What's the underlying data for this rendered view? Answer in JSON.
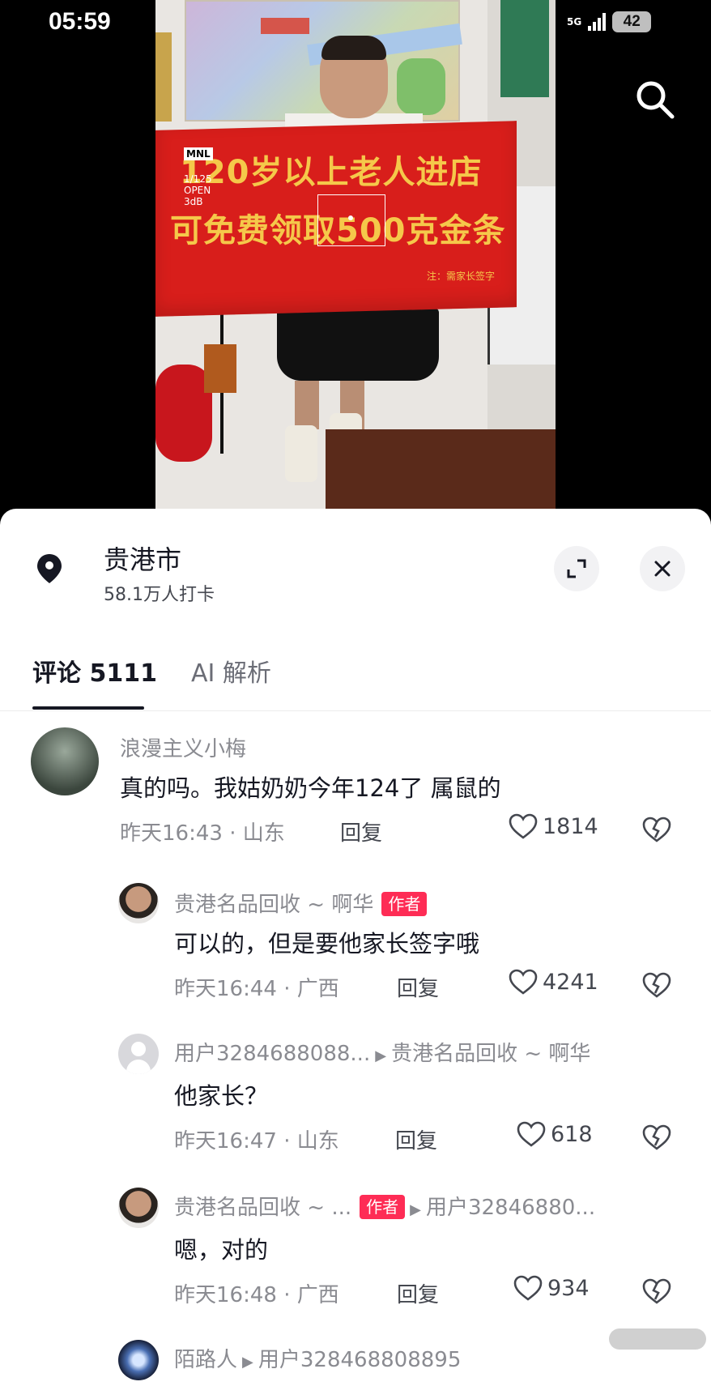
{
  "status_bar": {
    "time": "05:59",
    "network": "5G",
    "battery": "42"
  },
  "video": {
    "banner_line1": "120岁以上老人进店",
    "banner_line2": "可免费领取500克金条",
    "banner_note": "注：需家长签字",
    "camera_mode": "MNL",
    "camera_info": "1/125\nOPEN\n3dB"
  },
  "location": {
    "name": "贵港市",
    "checkins": "58.1万人打卡"
  },
  "tabs": [
    {
      "label": "评论 5111",
      "active": true
    },
    {
      "label": "AI 解析",
      "active": false
    }
  ],
  "comments": [
    {
      "user": "浪漫主义小梅",
      "text": "真的吗。我姑奶奶今年124了 属鼠的",
      "time": "昨天16:43 · 山东",
      "reply": "回复",
      "likes": "1814"
    },
    {
      "user": "贵港名品回收 ~ 啊华",
      "badge": "作者",
      "text": "可以的，但是要他家长签字哦",
      "time": "昨天16:44 · 广西",
      "reply": "回复",
      "likes": "4241"
    },
    {
      "user": "用户3284688088...",
      "reply_to": "贵港名品回收 ~ 啊华",
      "text": "他家长？",
      "time": "昨天16:47 · 山东",
      "reply": "回复",
      "likes": "618"
    },
    {
      "user": "贵港名品回收 ~ ...",
      "badge": "作者",
      "reply_to": "用户32846880...",
      "text": "嗯，对的",
      "time": "昨天16:48 · 广西",
      "reply": "回复",
      "likes": "934"
    },
    {
      "user": "陌路人",
      "reply_to": "用户328468808895"
    }
  ],
  "colors": {
    "accent": "#fe2c55",
    "text_primary": "#161823",
    "text_secondary": "#8a8b91"
  }
}
